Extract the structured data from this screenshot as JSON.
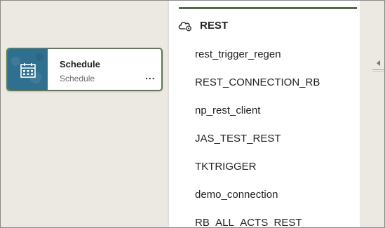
{
  "tile": {
    "title": "Schedule",
    "subtitle": "Schedule",
    "more": "..."
  },
  "panel": {
    "title": "REST",
    "items": [
      "rest_trigger_regen",
      "REST_CONNECTION_RB",
      "np_rest_client",
      "JAS_TEST_REST",
      "TKTRIGGER",
      "demo_connection",
      "RB_ALL_ACTS_REST"
    ]
  },
  "colors": {
    "accent": "#4f6b47",
    "tile_icon_bg": "#2f6f8f",
    "canvas_bg": "#ece8e2"
  }
}
